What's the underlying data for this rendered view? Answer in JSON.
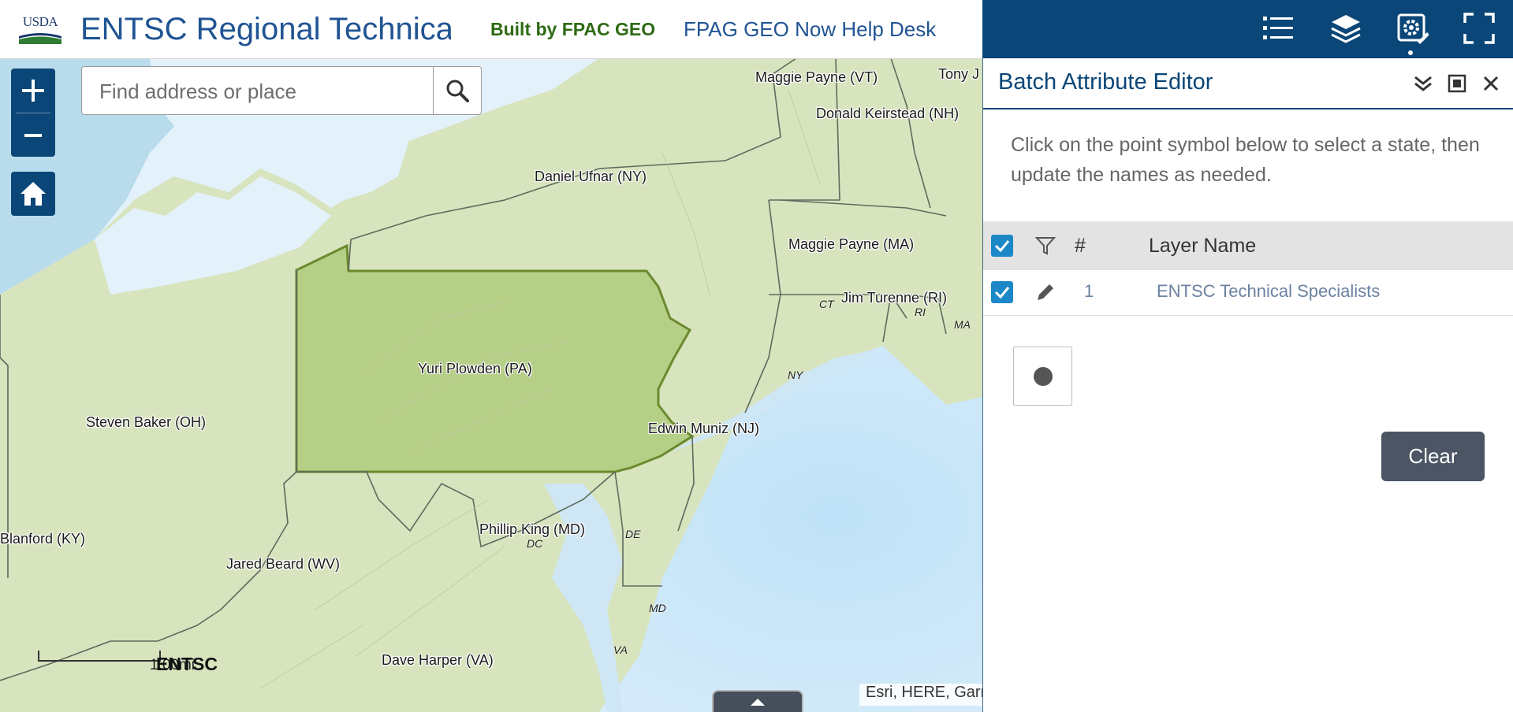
{
  "header": {
    "logo_text": "USDA",
    "title": "ENTSC Regional Technical Specialists",
    "link_built_by": "Built by FPAC GEO",
    "link_help": "FPAG GEO Now Help Desk"
  },
  "toolbar": {
    "icons": [
      "legend-list-icon",
      "layers-icon",
      "batch-editor-gear-icon",
      "fullscreen-icon"
    ],
    "active": "batch-editor-gear-icon",
    "color": "#0a4677"
  },
  "map": {
    "search_placeholder": "Find address or place",
    "labels": [
      "Maggie Payne (VT)",
      "Tony J",
      "Donald Keirstead (NH)",
      "Daniel Ufnar (NY)",
      "Maggie Payne (MA)",
      "Jim Turenne (RI)",
      "Yuri Plowden (PA)",
      "Steven Baker (OH)",
      "Edwin Muniz (NJ)",
      "Blanford (KY)",
      "Phillip King (MD)",
      "Jared Beard (WV)",
      "Dave Harper (VA)"
    ],
    "state_abbr": [
      "CT",
      "RI",
      "MA",
      "NY",
      "DC",
      "DE",
      "MD",
      "VA"
    ],
    "scale_label": "1.00mi",
    "overlay_text": "ENTSC",
    "attribution": "Esri, HERE, Garmin",
    "highlight_state": "PA",
    "colors": {
      "water": "#cfe6f5",
      "land": "#d7e4bd",
      "highlight": "#b5cf86",
      "highlight_border": "#6b8a2f"
    }
  },
  "panel": {
    "title": "Batch Attribute Editor",
    "instructions": "Click on the point symbol below to select a state, then update the names as needed.",
    "table": {
      "headers": {
        "number": "#",
        "layer_name": "Layer Name"
      },
      "rows": [
        {
          "number": "1",
          "layer_name": "ENTSC Technical Specialists"
        }
      ]
    },
    "clear_label": "Clear"
  }
}
